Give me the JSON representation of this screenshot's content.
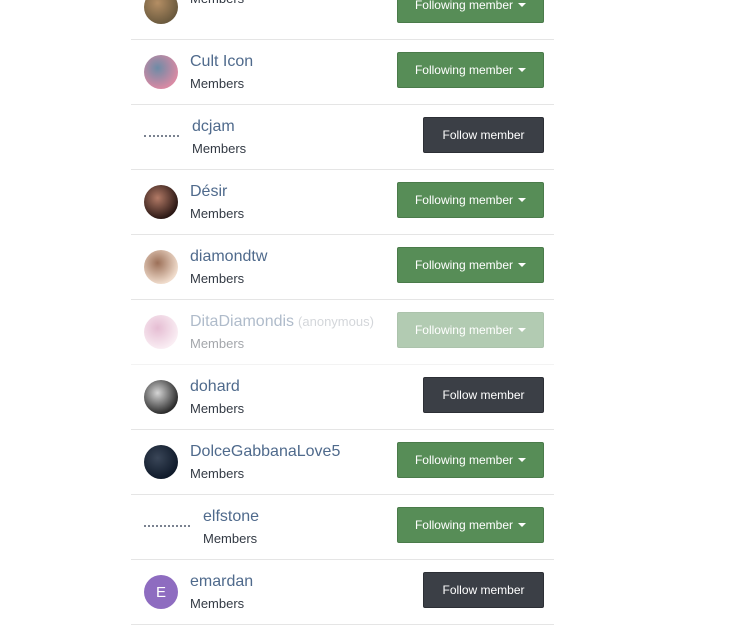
{
  "members": [
    {
      "name": "",
      "role": "Members",
      "button": "Following member",
      "state": "following",
      "avatar": "photo",
      "colors": [
        "#6b5a3e",
        "#b48e64"
      ]
    },
    {
      "name": "Cult Icon",
      "role": "Members",
      "button": "Following member",
      "state": "following",
      "avatar": "photo",
      "colors": [
        "#d98aa4",
        "#6d8ba6"
      ]
    },
    {
      "name": "dcjam",
      "role": "Members",
      "button": "Follow member",
      "state": "follow",
      "avatar": "dots"
    },
    {
      "name": "Désir",
      "role": "Members",
      "button": "Following member",
      "state": "following",
      "avatar": "photo",
      "colors": [
        "#2a1714",
        "#b27a66"
      ]
    },
    {
      "name": "diamondtw",
      "role": "Members",
      "button": "Following member",
      "state": "following",
      "avatar": "photo",
      "colors": [
        "#f0dccc",
        "#9c7058"
      ]
    },
    {
      "name": "DitaDiamondis",
      "anon": "(anonymous)",
      "role": "Members",
      "button": "Following member",
      "state": "following",
      "dimmed": true,
      "avatar": "photo",
      "colors": [
        "#f4d9e6",
        "#c76e9e"
      ]
    },
    {
      "name": "dohard",
      "role": "Members",
      "button": "Follow member",
      "state": "follow",
      "avatar": "photo",
      "colors": [
        "#2b2b2b",
        "#d5d5d5"
      ]
    },
    {
      "name": "DolceGabbanaLove5",
      "role": "Members",
      "button": "Following member",
      "state": "following",
      "avatar": "photo",
      "colors": [
        "#0f1a2a",
        "#3a4658"
      ]
    },
    {
      "name": "elfstone",
      "role": "Members",
      "button": "Following member",
      "state": "following",
      "avatar": "dots"
    },
    {
      "name": "emardan",
      "role": "Members",
      "button": "Follow member",
      "state": "follow",
      "avatar": "letter",
      "initial": "E"
    }
  ]
}
